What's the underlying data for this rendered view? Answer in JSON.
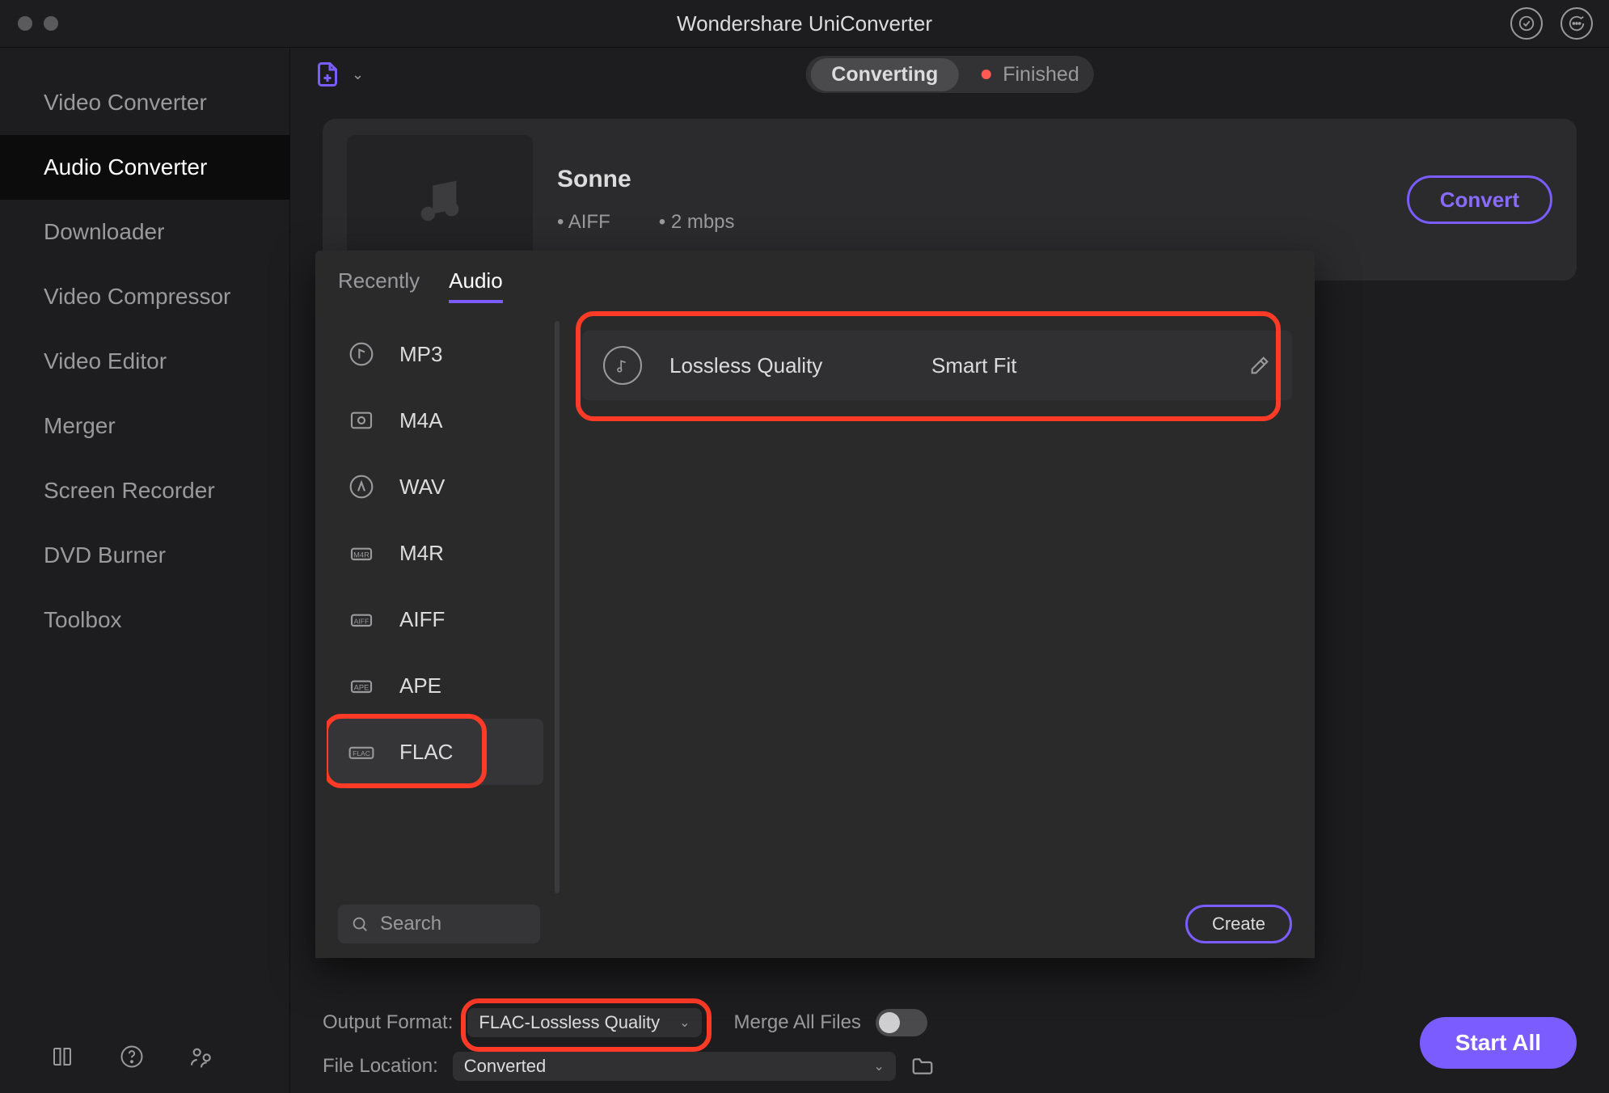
{
  "app": {
    "title": "Wondershare UniConverter"
  },
  "sidebar": {
    "items": [
      {
        "label": "Video Converter"
      },
      {
        "label": "Audio Converter"
      },
      {
        "label": "Downloader"
      },
      {
        "label": "Video Compressor"
      },
      {
        "label": "Video Editor"
      },
      {
        "label": "Merger"
      },
      {
        "label": "Screen Recorder"
      },
      {
        "label": "DVD Burner"
      },
      {
        "label": "Toolbox"
      }
    ],
    "active_index": 1
  },
  "tabs": {
    "current": "Converting",
    "finished": "Finished"
  },
  "file": {
    "title": "Sonne",
    "codec": "AIFF",
    "bitrate": "2 mbps"
  },
  "buttons": {
    "convert": "Convert",
    "create": "Create",
    "startall": "Start All"
  },
  "popup": {
    "tabs": {
      "recent": "Recently",
      "audio": "Audio"
    },
    "formats": [
      "MP3",
      "M4A",
      "WAV",
      "M4R",
      "AIFF",
      "APE",
      "FLAC"
    ],
    "active_format_index": 6,
    "quality_label": "Lossless Quality",
    "fit_label": "Smart Fit",
    "search_placeholder": "Search"
  },
  "bottom": {
    "output_label": "Output Format:",
    "output_value": "FLAC-Lossless Quality",
    "merge_label": "Merge All Files",
    "location_label": "File Location:",
    "location_value": "Converted"
  }
}
